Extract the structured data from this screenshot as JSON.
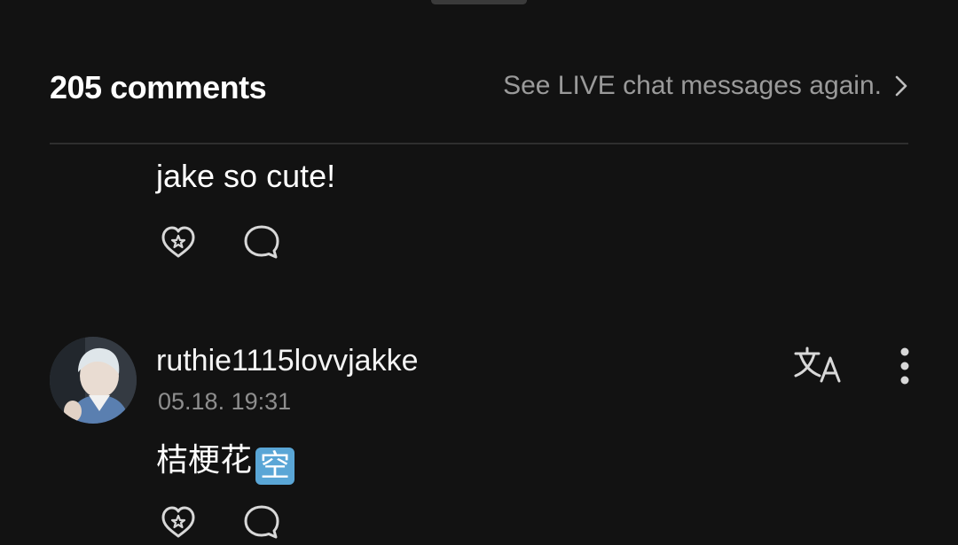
{
  "header": {
    "comment_count": "205 comments",
    "live_link": "See LIVE chat messages again."
  },
  "comments": [
    {
      "text": "jake so cute!"
    },
    {
      "username": "ruthie1115lovvjakke",
      "timestamp": "05.18. 19:31",
      "text": "桔梗花",
      "emoji": "空"
    }
  ],
  "icons": {
    "like": "heart-star-icon",
    "reply": "speech-bubble-icon",
    "translate": "translate-icon",
    "more": "more-vertical-icon",
    "chevron": "chevron-right-icon"
  },
  "colors": {
    "background": "#121212",
    "text_primary": "#ffffff",
    "text_secondary": "#8e8e8e",
    "divider": "#2e2e2e",
    "emoji_bg": "#5aa6d6"
  }
}
